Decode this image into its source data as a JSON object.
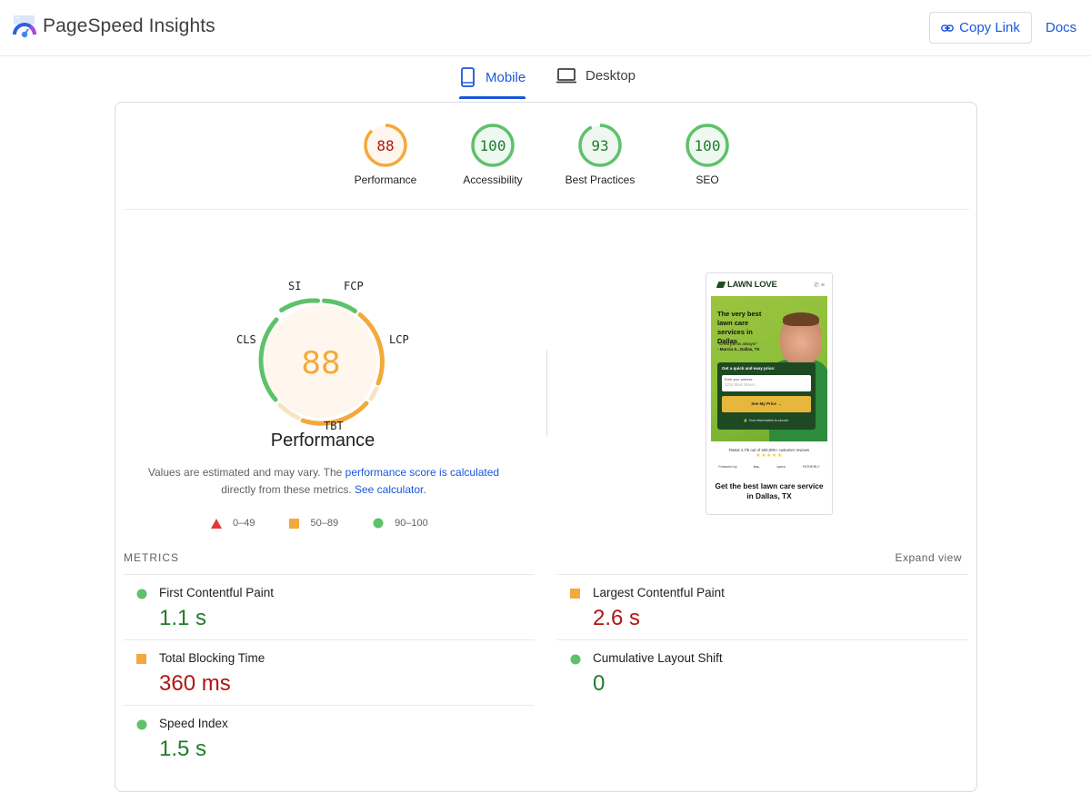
{
  "header": {
    "title": "PageSpeed Insights",
    "copy_link": "Copy Link",
    "docs": "Docs"
  },
  "tabs": [
    {
      "label": "Mobile",
      "icon": "smartphone-icon",
      "active": true
    },
    {
      "label": "Desktop",
      "icon": "laptop-icon",
      "active": false
    }
  ],
  "categories": [
    {
      "label": "Performance",
      "score": "88",
      "rating": "average"
    },
    {
      "label": "Accessibility",
      "score": "100",
      "rating": "good"
    },
    {
      "label": "Best Practices",
      "score": "93",
      "rating": "good"
    },
    {
      "label": "SEO",
      "score": "100",
      "rating": "good"
    }
  ],
  "performance": {
    "score": "88",
    "title": "Performance",
    "gauge_labels": {
      "si": "SI",
      "fcp": "FCP",
      "lcp": "LCP",
      "tbt": "TBT",
      "cls": "CLS"
    },
    "note_text": "Values are estimated and may vary. The ",
    "note_link1": "performance score is calculated",
    "note_text2": " directly from these metrics. ",
    "note_link2": "See calculator."
  },
  "legend": [
    {
      "range": "0–49",
      "symbol": "triangle",
      "color": "#e53935"
    },
    {
      "range": "50–89",
      "symbol": "square",
      "color": "#f4a93c"
    },
    {
      "range": "90–100",
      "symbol": "circle",
      "color": "#5ec16b"
    }
  ],
  "screenshot": {
    "brand": "LAWN LOVE",
    "headline": "The very best lawn care services in Dallas",
    "quote": "\"Great job as always!\"",
    "quote_author": "- Marcia S., Dallas, TX",
    "form_label": "Get a quick and easy price:",
    "address_label": "Enter your address",
    "address_placeholder": "1234 Main Street...",
    "cta_button": "See My Price →",
    "secure_note": "🔒 Your information is secure.",
    "rated": "Rated 4.7/5 out of 400,000+ customer reviews",
    "stars": "★★★★★",
    "featured": [
      "Featured by",
      "Inc.",
      "apsnr",
      "FATHERLY"
    ],
    "cta_text": "Get the best lawn care service in Dallas, TX"
  },
  "metrics": {
    "heading": "METRICS",
    "expand": "Expand view",
    "items": [
      {
        "name": "First Contentful Paint",
        "value": "1.1 s",
        "rating": "good"
      },
      {
        "name": "Largest Contentful Paint",
        "value": "2.6 s",
        "rating": "average"
      },
      {
        "name": "Total Blocking Time",
        "value": "360 ms",
        "rating": "average"
      },
      {
        "name": "Cumulative Layout Shift",
        "value": "0",
        "rating": "good"
      },
      {
        "name": "Speed Index",
        "value": "1.5 s",
        "rating": "good"
      }
    ]
  },
  "colors": {
    "accent": "#1a56db",
    "good": "#5ec16b",
    "good_text": "#1e7d2b",
    "average": "#f4a93c",
    "average_text": "#b31412",
    "poor": "#e53935"
  }
}
